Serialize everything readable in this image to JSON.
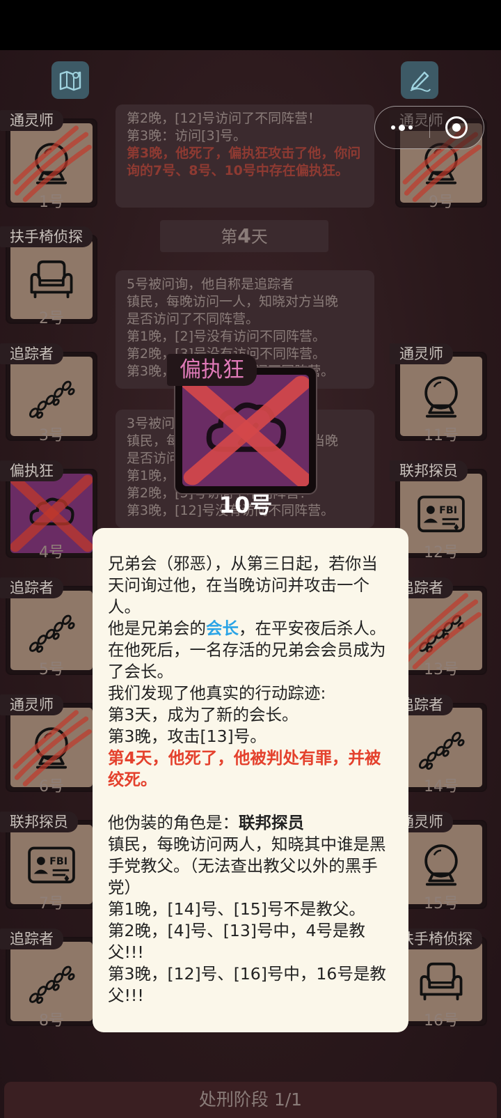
{
  "left_players": [
    {
      "role": "通灵师",
      "num": "1号",
      "icon": "crystal-ball-icon",
      "clawed": true
    },
    {
      "role": "扶手椅侦探",
      "num": "2号",
      "icon": "armchair-icon",
      "clawed": false
    },
    {
      "role": "追踪者",
      "num": "3号",
      "icon": "footprints-icon",
      "clawed": false
    },
    {
      "role": "偏执狂",
      "num": "4号",
      "icon": "cloud-icon",
      "clawed": false,
      "crossed": true
    },
    {
      "role": "追踪者",
      "num": "5号",
      "icon": "footprints-icon",
      "clawed": false
    },
    {
      "role": "通灵师",
      "num": "6号",
      "icon": "crystal-ball-icon",
      "clawed": true
    },
    {
      "role": "联邦探员",
      "num": "7号",
      "icon": "fbi-badge-icon",
      "clawed": false
    },
    {
      "role": "追踪者",
      "num": "8号",
      "icon": "footprints-icon",
      "clawed": false
    }
  ],
  "right_players": [
    {
      "role": "通灵师",
      "num": "9号",
      "icon": "crystal-ball-icon",
      "clawed": true
    },
    {
      "role": "通灵师",
      "num": "11号",
      "icon": "crystal-ball-icon",
      "clawed": false
    },
    {
      "role": "联邦探员",
      "num": "12号",
      "icon": "fbi-badge-icon",
      "clawed": false
    },
    {
      "role": "追踪者",
      "num": "13号",
      "icon": "footprints-icon",
      "clawed": true
    },
    {
      "role": "追踪者",
      "num": "14号",
      "icon": "footprints-icon",
      "clawed": false
    },
    {
      "role": "通灵师",
      "num": "15号",
      "icon": "crystal-ball-icon",
      "clawed": false
    },
    {
      "role": "扶手椅侦探",
      "num": "16号",
      "icon": "armchair-icon",
      "clawed": false
    }
  ],
  "feed": {
    "box1": {
      "lines": [
        "第2晚，[12]号访问了不同阵营！",
        "第3晚：访问[3]号。"
      ],
      "red": "第3晚，他死了，偏执狂攻击了他，你问询的7号、8号、10号中存在偏执狂。"
    },
    "day_prefix": "第",
    "day_num": "4",
    "day_suffix": "天",
    "box2_lines": [
      "5号被问询，他自称是追踪者",
      "镇民，每晚访问一人，知晓对方当晚",
      "是否访问了不同阵营。",
      "第1晚，[2]号没有访问不同阵营。",
      "第2晚，[3]号没有访问不同阵营。",
      "第3晚，[14]号没有访问不同阵营。"
    ],
    "box3_lines": [
      "3号被问询，他自称是追踪者",
      "镇民，每晚访问一人，知晓对方当晚",
      "是否访问了不同阵营。",
      "第1晚，[4]号没有访问不同阵营。",
      "第2晚，[5]号访问了不同阵营！",
      "第3晚，[12]号没有访问不同阵营。"
    ]
  },
  "highlight": {
    "role": "偏执狂",
    "num": "10号",
    "icon": "cloud-icon"
  },
  "popup": {
    "p1": "兄弟会（邪恶），从第三日起，若你当天问询过他，在当晚访问并攻击一个人。",
    "p2_a": "他是兄弟会的",
    "p2_link": "会长",
    "p2_b": "，在平安夜后杀人。在他死后，一名存活的兄弟会会员成为了会长。",
    "p3": "我们发现了他真实的行动踪迹:",
    "p4": "第3天，成为了新的会长。",
    "p5": "第3晚，攻击[13]号。",
    "p6_red": "第4天，他死了，他被判处有罪，并被绞死。",
    "p7_a": "他伪装的角色是：",
    "p7_b": "联邦探员",
    "p8": "镇民，每晚访问两人，知晓其中谁是黑手党教父。（无法查出教父以外的黑手党）",
    "p9": "第1晚，[14]号、[15]号不是教父。",
    "p10": "第2晚，[4]号、[13]号中，4号是教父!!!",
    "p11": "第3晚，[12]号、[16]号中，16号是教父!!!"
  },
  "bottom": {
    "label": "处刑阶段 1/1"
  },
  "colors": {
    "accent_red": "#e4412d",
    "link_blue": "#2aa4e6",
    "role_pink": "#e07ab8"
  }
}
